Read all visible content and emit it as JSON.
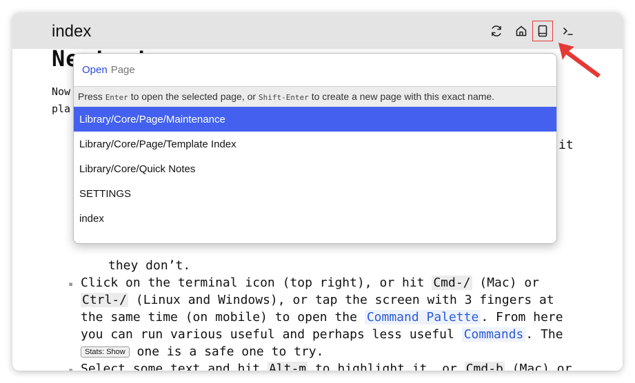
{
  "window": {
    "title": "index",
    "toolbar": {
      "reload_icon": "reload-icon",
      "home_icon": "home-icon",
      "book_icon": "book-icon",
      "terminal_icon": "terminal-icon"
    }
  },
  "page": {
    "heading": "Next steps",
    "intro_line1": "Now",
    "intro_line2": "pla",
    "tail_it": "it",
    "they_dont": "they don’t.",
    "item2": {
      "l1_a": "Click on the terminal icon (top right), or hit ",
      "l1_code": "Cmd-/",
      "l1_b": " (Mac) or",
      "l2_code": "Ctrl-/",
      "l2_b": " (Linux and Windows), or tap the screen with 3 fingers at",
      "l3_a": "the same time (on mobile) to open the ",
      "l3_link": "Command Palette",
      "l3_b": ". From here",
      "l4_a": "you can run various useful and perhaps less useful ",
      "l4_link": "Commands",
      "l4_b": ". The",
      "l5_button": "Stats: Show",
      "l5_b": " one is a safe one to try."
    },
    "item3": {
      "l1_a": "Select some text and hit ",
      "l1_code1": "Alt-m",
      "l1_b": " to highlight it, or ",
      "l1_code2": "Cmd-b",
      "l1_c": " (Mac) or"
    }
  },
  "modal": {
    "label": "Open",
    "placeholder": "Page",
    "hint_a": "Press ",
    "hint_key1": "Enter",
    "hint_b": " to open the selected page, or ",
    "hint_key2": "Shift-Enter",
    "hint_c": " to create a new page with this exact name.",
    "options": [
      "Library/Core/Page/Maintenance",
      "Library/Core/Page/Template Index",
      "Library/Core/Quick Notes",
      "SETTINGS",
      "index"
    ],
    "selected_index": 0
  },
  "colors": {
    "accent": "#4361ee",
    "label_blue": "#2b49d8",
    "annotation_red": "#e53935"
  }
}
